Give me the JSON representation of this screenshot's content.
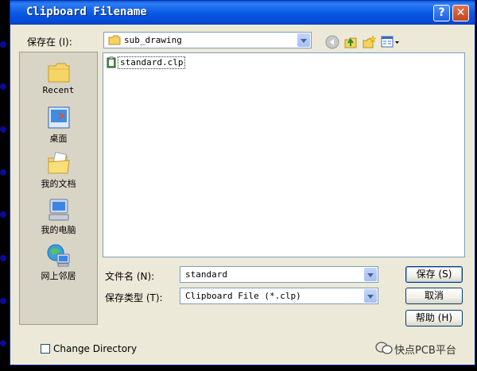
{
  "window": {
    "title": "Clipboard Filename"
  },
  "titlebar": {
    "help_label": "?",
    "close_label": "✕"
  },
  "location": {
    "label": "保存在 (I):",
    "folder": "sub_drawing"
  },
  "places": [
    {
      "label": "Recent",
      "icon": "recent-folder-icon"
    },
    {
      "label": "桌面",
      "icon": "desktop-icon"
    },
    {
      "label": "我的文档",
      "icon": "my-documents-icon"
    },
    {
      "label": "我的电脑",
      "icon": "my-computer-icon"
    },
    {
      "label": "网上邻居",
      "icon": "network-places-icon"
    }
  ],
  "files": [
    {
      "name": "standard.clp",
      "icon": "clipboard-file-icon"
    }
  ],
  "filename": {
    "label": "文件名 (N):",
    "value": "standard"
  },
  "filetype": {
    "label": "保存类型 (T):",
    "value": "Clipboard File (*.clp)"
  },
  "buttons": {
    "save": "保存 (S)",
    "cancel": "取消",
    "help": "帮助 (H)"
  },
  "change_directory": {
    "label": "Change Directory",
    "checked": false
  },
  "watermark": "快点PCB平台"
}
